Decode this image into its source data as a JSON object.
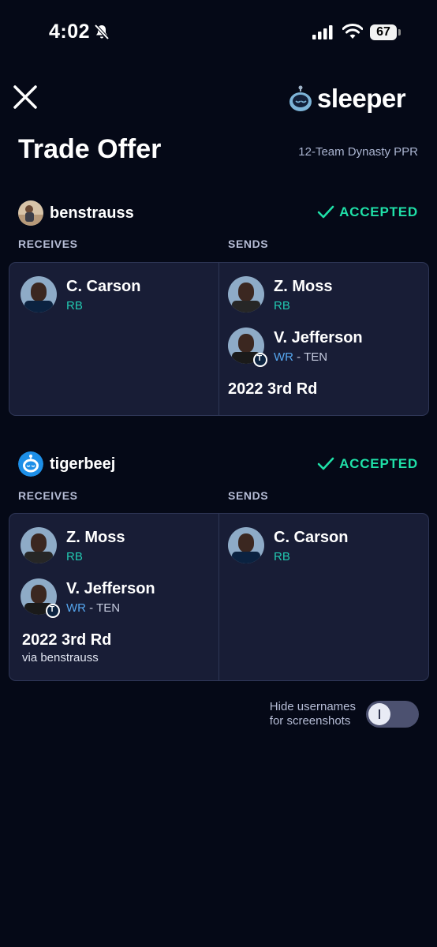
{
  "status_bar": {
    "time": "4:02",
    "battery": "67"
  },
  "header": {
    "brand": "sleeper"
  },
  "page": {
    "title": "Trade Offer",
    "league": "12-Team Dynasty PPR"
  },
  "labels": {
    "receives": "RECEIVES",
    "sends": "SENDS"
  },
  "trade_sides": [
    {
      "username": "benstrauss",
      "status": "ACCEPTED",
      "receives": [
        {
          "name": "C. Carson",
          "position": "RB",
          "team": ""
        }
      ],
      "sends": [
        {
          "name": "Z. Moss",
          "position": "RB",
          "team": ""
        },
        {
          "name": "V. Jefferson",
          "position": "WR",
          "team": "- TEN"
        }
      ],
      "sends_pick": {
        "name": "2022 3rd Rd"
      }
    },
    {
      "username": "tigerbeej",
      "status": "ACCEPTED",
      "receives": [
        {
          "name": "Z. Moss",
          "position": "RB",
          "team": ""
        },
        {
          "name": "V. Jefferson",
          "position": "WR",
          "team": "- TEN"
        }
      ],
      "receives_pick": {
        "name": "2022 3rd Rd",
        "via": "via benstrauss"
      },
      "sends": [
        {
          "name": "C. Carson",
          "position": "RB",
          "team": ""
        }
      ]
    }
  ],
  "toggle": {
    "label_line1": "Hide usernames",
    "label_line2": "for screenshots",
    "on": false
  },
  "colors": {
    "accepted": "#1fe0a8",
    "rb": "#22c9b1",
    "wr": "#56a7f0",
    "background": "#050917",
    "card": "#181d36"
  }
}
